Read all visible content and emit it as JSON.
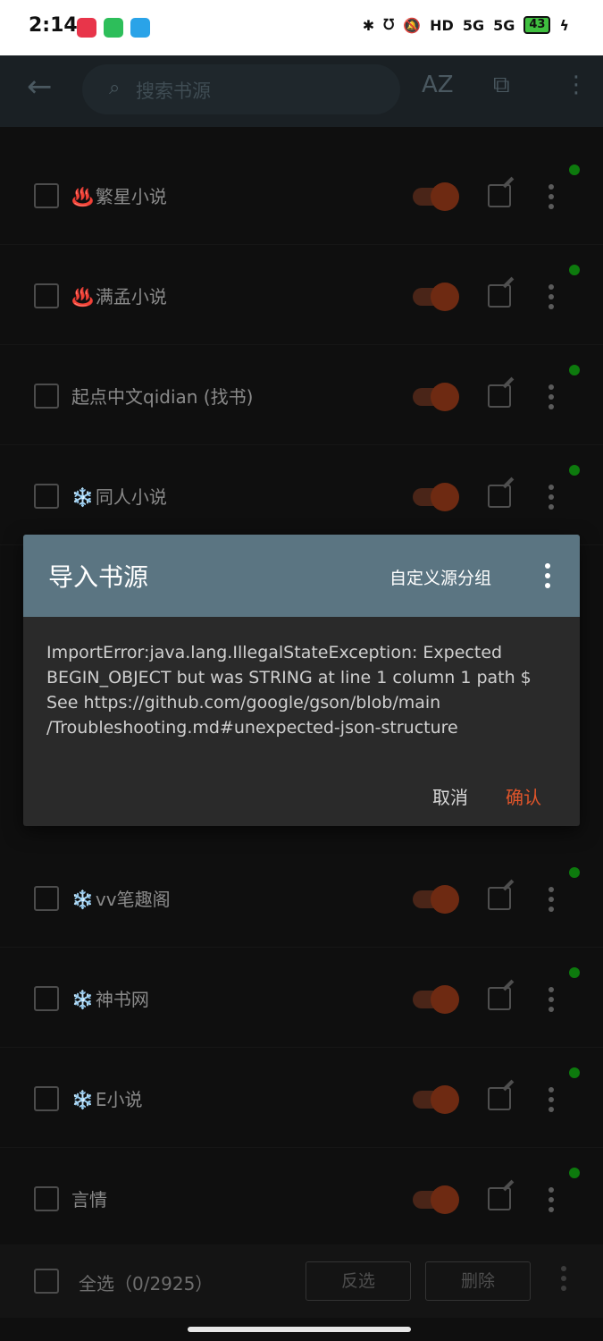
{
  "status_bar": {
    "time": "2:14",
    "network1": "5G",
    "network2": "5G",
    "hd": "HD",
    "battery": "43"
  },
  "toolbar": {
    "search_placeholder": "搜索书源",
    "sort_label": "AZ"
  },
  "sources": [
    {
      "prefix": "♨️",
      "name": "繁星小说"
    },
    {
      "prefix": "♨️",
      "name": "满孟小说"
    },
    {
      "prefix": "",
      "name": "起点中文qidian (找书)"
    },
    {
      "prefix": "❄️",
      "name": "同人小说"
    },
    {
      "prefix": "❄️",
      "name": "vv笔趣阁"
    },
    {
      "prefix": "❄️",
      "name": "神书网"
    },
    {
      "prefix": "❄️",
      "name": "E小说"
    },
    {
      "prefix": "",
      "name": "言情"
    }
  ],
  "bottom_bar": {
    "select_all": "全选（0/2925）",
    "invert": "反选",
    "delete": "删除"
  },
  "dialog": {
    "title": "导入书源",
    "group_label": "自定义源分组",
    "message": "ImportError:java.lang.IllegalStateException: Expected BEGIN_OBJECT but was STRING at line 1 column 1 path $\nSee https://github.com/google/gson/blob/main\n/Troubleshooting.md#unexpected-json-structure",
    "cancel": "取消",
    "confirm": "确认"
  },
  "colors": {
    "dialog_header": "#5b7582",
    "confirm": "#e0552a",
    "enabled_dot": "#0d7a0d"
  }
}
